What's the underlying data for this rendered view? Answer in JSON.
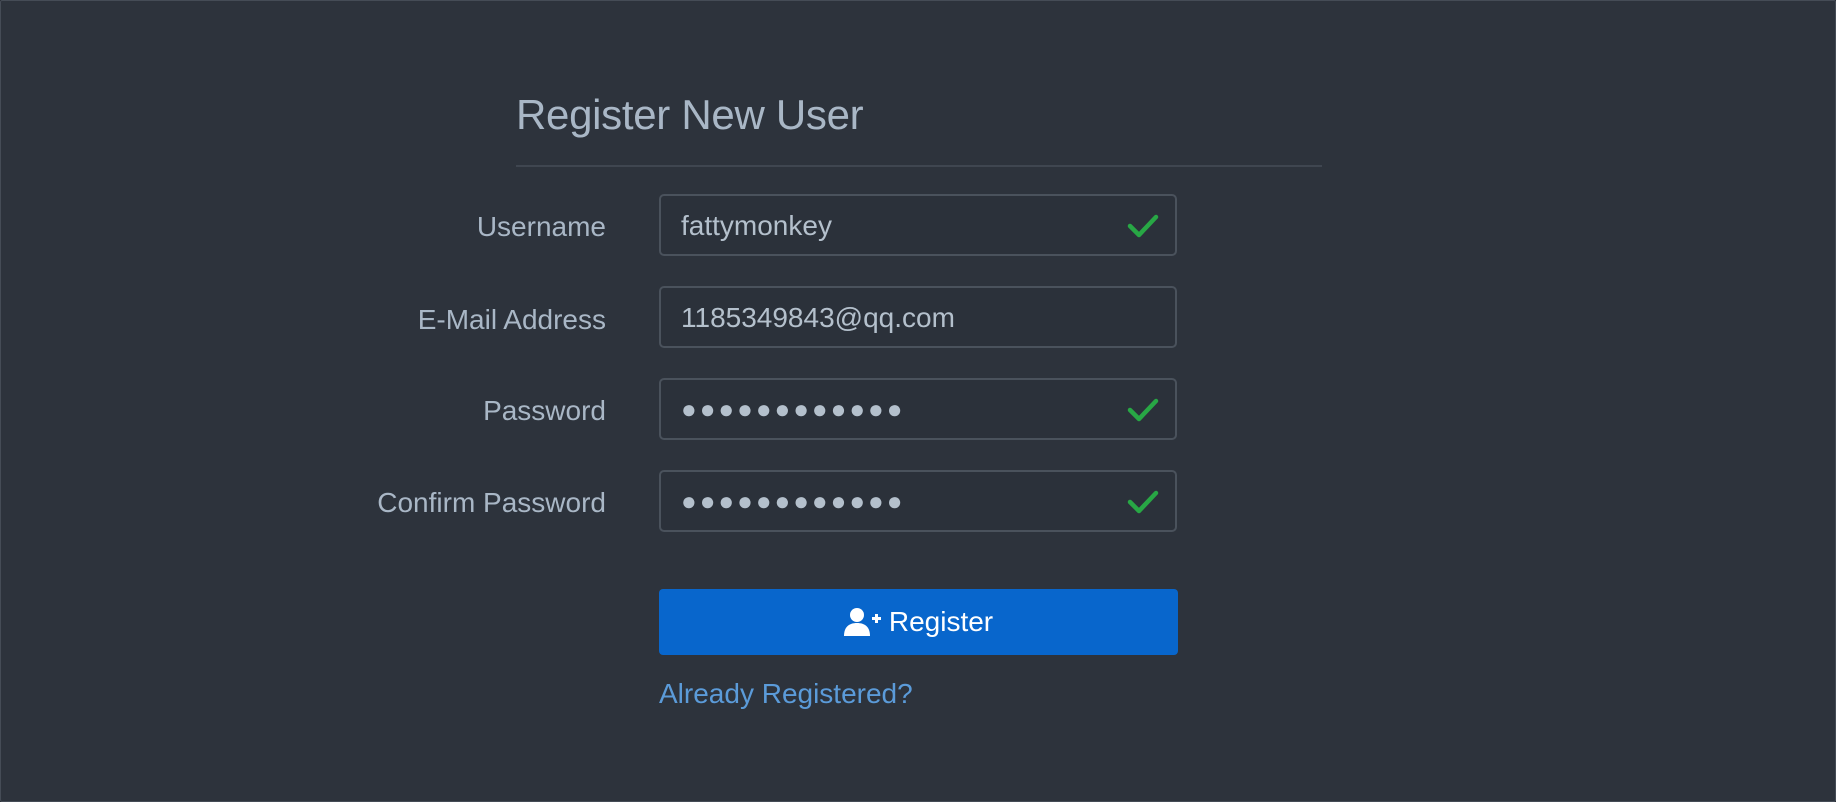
{
  "form": {
    "title": "Register New User",
    "fields": {
      "username": {
        "label": "Username",
        "value": "fattymonkey",
        "valid": true,
        "icon": "check-icon"
      },
      "email": {
        "label": "E-Mail Address",
        "value": "1185349843@qq.com"
      },
      "password": {
        "label": "Password",
        "value": "●●●●●●●●●●●●",
        "valid": true,
        "icon": "check-icon"
      },
      "confirm_password": {
        "label": "Confirm Password",
        "value": "●●●●●●●●●●●●",
        "valid": true,
        "icon": "check-icon"
      }
    },
    "register_button": {
      "label": "Register",
      "icon": "user-plus-icon"
    },
    "login_link": "Already Registered?"
  },
  "colors": {
    "background": "#2d333c",
    "text": "#a9b7c6",
    "primary": "#0866cc",
    "link": "#5b9bd9",
    "valid": "#28a745"
  }
}
